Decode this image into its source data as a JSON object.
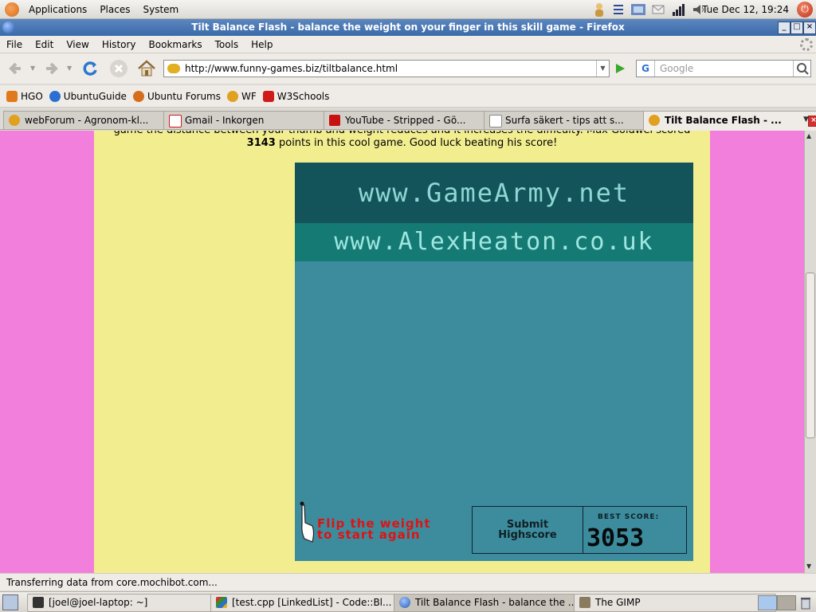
{
  "top_panel": {
    "menus": [
      "Applications",
      "Places",
      "System"
    ],
    "clock": "Tue Dec 12, 19:24"
  },
  "window": {
    "title": "Tilt Balance Flash - balance the weight on your finger in this skill game - Firefox"
  },
  "menubar": [
    "File",
    "Edit",
    "View",
    "History",
    "Bookmarks",
    "Tools",
    "Help"
  ],
  "navbar": {
    "url": "http://www.funny-games.biz/tiltbalance.html",
    "search_placeholder": "Google"
  },
  "bookmarks": [
    {
      "label": "HGO",
      "color": "#e07a1a"
    },
    {
      "label": "UbuntuGuide",
      "color": "#2a6fd1"
    },
    {
      "label": "Ubuntu Forums",
      "color": "#d46d1c"
    },
    {
      "label": "WF",
      "color": "#e0a020"
    },
    {
      "label": "W3Schools",
      "color": "#d01a1a"
    }
  ],
  "tabs": [
    {
      "label": "webForum - Agronom-kl...",
      "color": "#e0a020"
    },
    {
      "label": "Gmail - Inkorgen",
      "color": "#d01a1a"
    },
    {
      "label": "YouTube - Stripped - Gö...",
      "color": "#c81010"
    },
    {
      "label": "Surfa säkert - tips att s...",
      "color": "#ffffff"
    },
    {
      "label": "Tilt Balance Flash - ...",
      "color": "#e0a020"
    }
  ],
  "page": {
    "intro_line1": "game the distance between your thumb and weight reduces and it increases the difficulty. Max Goldwel scored",
    "intro_score": "3143",
    "intro_line2": " points in this cool game. Good luck beating his score!",
    "game": {
      "banner1": "www.GameArmy.net",
      "banner2": "www.AlexHeaton.co.uk",
      "flip_line1": "Flip the weight",
      "flip_line2": "to start again",
      "submit_line1": "Submit",
      "submit_line2": "Highscore",
      "best_label": "BEST SCORE:",
      "best_value": "3053"
    }
  },
  "status": "Transferring data from core.mochibot.com...",
  "taskbar": [
    {
      "label": "[joel@joel-laptop: ~]",
      "color": "#333333"
    },
    {
      "label": "[test.cpp [LinkedList] - Code::Bl...",
      "color": "#4a9f2a"
    },
    {
      "label": "Tilt Balance Flash - balance the ...",
      "color": "#2a6fd1"
    },
    {
      "label": "The GIMP",
      "color": "#8a7a60"
    }
  ]
}
